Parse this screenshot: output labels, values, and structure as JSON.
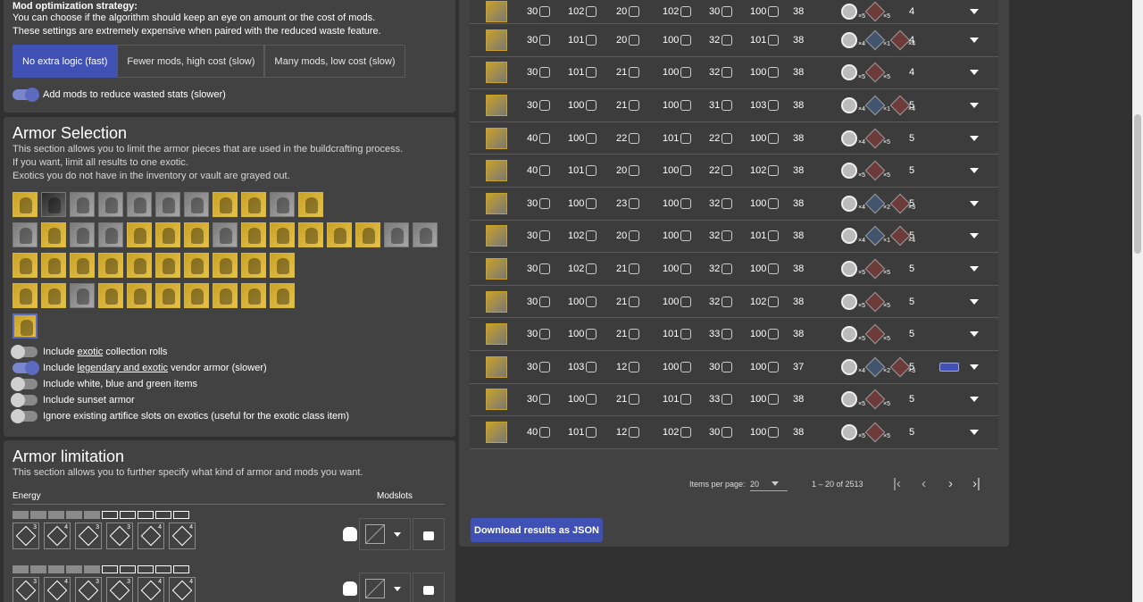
{
  "mod_opt": {
    "title": "Mod optimization strategy:",
    "desc1": "You can choose if the algorithm should keep an eye on amount or the cost of mods.",
    "desc2": "These settings are extremely expensive when paired with the reduced waste feature.",
    "buttons": [
      "No extra logic (fast)",
      "Fewer mods, high cost (slow)",
      "Many mods, low cost (slow)"
    ],
    "toggle_label": "Add mods to reduce wasted stats (slower)"
  },
  "armor_selection": {
    "title": "Armor Selection",
    "desc1": "This section allows you to limit the armor pieces that are used in the buildcrafting process.",
    "desc2": "If you want, limit all results to one exotic.",
    "desc3": "Exotics you do not have in the inventory or vault are grayed out.",
    "toggles": [
      {
        "pre": "Include ",
        "u": "exotic",
        "post": " collection rolls",
        "on": false
      },
      {
        "pre": "Include ",
        "u": "legendary and exotic",
        "post": " vendor armor (slower)",
        "on": true
      },
      {
        "pre": "Include white, blue and green items",
        "u": "",
        "post": "",
        "on": false
      },
      {
        "pre": "Include sunset armor",
        "u": "",
        "post": "",
        "on": false
      },
      {
        "pre": "Ignore existing artifice slots on exotics (useful for the exotic class item)",
        "u": "",
        "post": "",
        "on": false
      }
    ]
  },
  "armor_limitation": {
    "title": "Armor limitation",
    "desc": "This section allows you to further specify what kind of armor and mods you want.",
    "energy_label": "Energy",
    "modslots_label": "Modslots",
    "mod_sups": [
      "3",
      "4",
      "3",
      "3",
      "4",
      "4"
    ]
  },
  "results": {
    "rows": [
      {
        "s": [
          "30",
          "102",
          "20",
          "102",
          "30",
          "100"
        ],
        "t": "38",
        "mods": [
          [
            "c",
            "5"
          ],
          [
            "red",
            "5"
          ]
        ],
        "cnt": "4",
        "extra": false
      },
      {
        "s": [
          "30",
          "101",
          "20",
          "100",
          "32",
          "101"
        ],
        "t": "38",
        "mods": [
          [
            "c",
            "4"
          ],
          [
            "blue",
            "1"
          ],
          [
            "red",
            "4"
          ]
        ],
        "cnt": "4",
        "extra": false
      },
      {
        "s": [
          "30",
          "101",
          "21",
          "100",
          "32",
          "100"
        ],
        "t": "38",
        "mods": [
          [
            "c",
            "5"
          ],
          [
            "red",
            "5"
          ]
        ],
        "cnt": "4",
        "extra": false
      },
      {
        "s": [
          "30",
          "100",
          "21",
          "100",
          "31",
          "103"
        ],
        "t": "38",
        "mods": [
          [
            "c",
            "4"
          ],
          [
            "blue",
            "1"
          ],
          [
            "red",
            "4"
          ]
        ],
        "cnt": "5",
        "extra": false
      },
      {
        "s": [
          "40",
          "100",
          "22",
          "101",
          "22",
          "100"
        ],
        "t": "38",
        "mods": [
          [
            "c",
            "4"
          ],
          [
            "red",
            "5"
          ]
        ],
        "cnt": "5",
        "extra": false
      },
      {
        "s": [
          "40",
          "101",
          "20",
          "100",
          "22",
          "102"
        ],
        "t": "38",
        "mods": [
          [
            "c",
            "5"
          ],
          [
            "red",
            "5"
          ]
        ],
        "cnt": "5",
        "extra": false
      },
      {
        "s": [
          "30",
          "100",
          "23",
          "100",
          "32",
          "100"
        ],
        "t": "38",
        "mods": [
          [
            "c",
            "4"
          ],
          [
            "blue",
            "2"
          ],
          [
            "red",
            "3"
          ]
        ],
        "cnt": "5",
        "extra": false
      },
      {
        "s": [
          "30",
          "102",
          "20",
          "100",
          "32",
          "101"
        ],
        "t": "38",
        "mods": [
          [
            "c",
            "4"
          ],
          [
            "blue",
            "1"
          ],
          [
            "red",
            "4"
          ]
        ],
        "cnt": "5",
        "extra": false
      },
      {
        "s": [
          "30",
          "102",
          "21",
          "100",
          "32",
          "100"
        ],
        "t": "38",
        "mods": [
          [
            "c",
            "5"
          ],
          [
            "red",
            "5"
          ]
        ],
        "cnt": "5",
        "extra": false
      },
      {
        "s": [
          "30",
          "100",
          "21",
          "100",
          "32",
          "102"
        ],
        "t": "38",
        "mods": [
          [
            "c",
            "5"
          ],
          [
            "red",
            "5"
          ]
        ],
        "cnt": "5",
        "extra": false
      },
      {
        "s": [
          "30",
          "100",
          "21",
          "101",
          "33",
          "100"
        ],
        "t": "38",
        "mods": [
          [
            "c",
            "5"
          ],
          [
            "red",
            "5"
          ]
        ],
        "cnt": "5",
        "extra": false
      },
      {
        "s": [
          "30",
          "103",
          "12",
          "100",
          "30",
          "100"
        ],
        "t": "37",
        "mods": [
          [
            "c",
            "4"
          ],
          [
            "blue",
            "2"
          ],
          [
            "red",
            "3"
          ]
        ],
        "cnt": "5",
        "extra": true
      },
      {
        "s": [
          "30",
          "100",
          "21",
          "101",
          "33",
          "100"
        ],
        "t": "38",
        "mods": [
          [
            "c",
            "5"
          ],
          [
            "red",
            "5"
          ]
        ],
        "cnt": "5",
        "extra": false
      },
      {
        "s": [
          "40",
          "101",
          "12",
          "102",
          "30",
          "100"
        ],
        "t": "38",
        "mods": [
          [
            "c",
            "5"
          ],
          [
            "red",
            "5"
          ]
        ],
        "cnt": "5",
        "extra": false
      }
    ],
    "items_per_page_label": "Items per page:",
    "items_per_page": "20",
    "range": "1 – 20 of 2513",
    "download": "Download results as JSON"
  }
}
